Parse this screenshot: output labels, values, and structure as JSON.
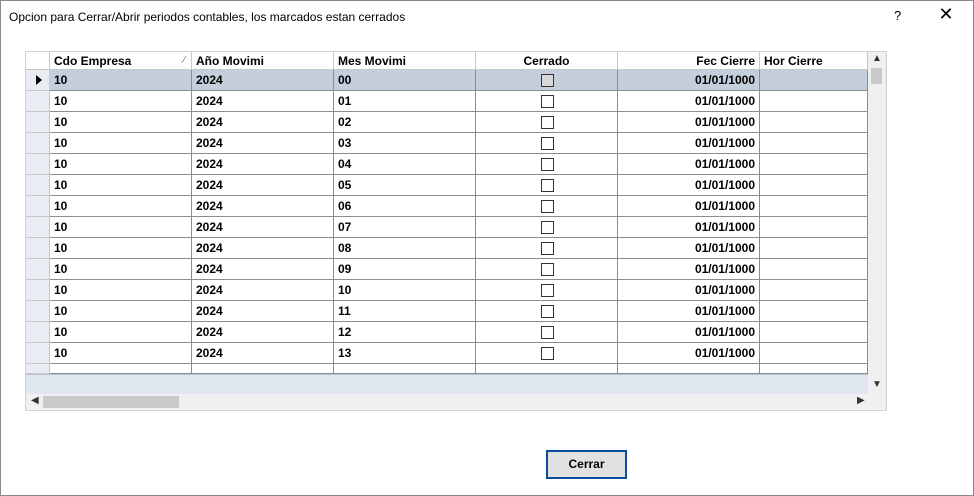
{
  "window": {
    "title": "Opcion para Cerrar/Abrir periodos contables, los marcados estan cerrados",
    "help_label": "?",
    "close_label": "✕"
  },
  "grid": {
    "columns": [
      "Cdo Empresa",
      "Año Movimi",
      "Mes Movimi",
      "Cerrado",
      "Fec Cierre",
      "Hor Cierre"
    ],
    "sort_indicator": "⁄",
    "rows": [
      {
        "empresa": "10",
        "anio": "2024",
        "mes": "00",
        "cerrado": false,
        "fec": "01/01/1000",
        "hor": ""
      },
      {
        "empresa": "10",
        "anio": "2024",
        "mes": "01",
        "cerrado": false,
        "fec": "01/01/1000",
        "hor": ""
      },
      {
        "empresa": "10",
        "anio": "2024",
        "mes": "02",
        "cerrado": false,
        "fec": "01/01/1000",
        "hor": ""
      },
      {
        "empresa": "10",
        "anio": "2024",
        "mes": "03",
        "cerrado": false,
        "fec": "01/01/1000",
        "hor": ""
      },
      {
        "empresa": "10",
        "anio": "2024",
        "mes": "04",
        "cerrado": false,
        "fec": "01/01/1000",
        "hor": ""
      },
      {
        "empresa": "10",
        "anio": "2024",
        "mes": "05",
        "cerrado": false,
        "fec": "01/01/1000",
        "hor": ""
      },
      {
        "empresa": "10",
        "anio": "2024",
        "mes": "06",
        "cerrado": false,
        "fec": "01/01/1000",
        "hor": ""
      },
      {
        "empresa": "10",
        "anio": "2024",
        "mes": "07",
        "cerrado": false,
        "fec": "01/01/1000",
        "hor": ""
      },
      {
        "empresa": "10",
        "anio": "2024",
        "mes": "08",
        "cerrado": false,
        "fec": "01/01/1000",
        "hor": ""
      },
      {
        "empresa": "10",
        "anio": "2024",
        "mes": "09",
        "cerrado": false,
        "fec": "01/01/1000",
        "hor": ""
      },
      {
        "empresa": "10",
        "anio": "2024",
        "mes": "10",
        "cerrado": false,
        "fec": "01/01/1000",
        "hor": ""
      },
      {
        "empresa": "10",
        "anio": "2024",
        "mes": "11",
        "cerrado": false,
        "fec": "01/01/1000",
        "hor": ""
      },
      {
        "empresa": "10",
        "anio": "2024",
        "mes": "12",
        "cerrado": false,
        "fec": "01/01/1000",
        "hor": ""
      },
      {
        "empresa": "10",
        "anio": "2024",
        "mes": "13",
        "cerrado": false,
        "fec": "01/01/1000",
        "hor": ""
      }
    ],
    "selected_row": 0
  },
  "buttons": {
    "cerrar_label": "Cerrar"
  }
}
